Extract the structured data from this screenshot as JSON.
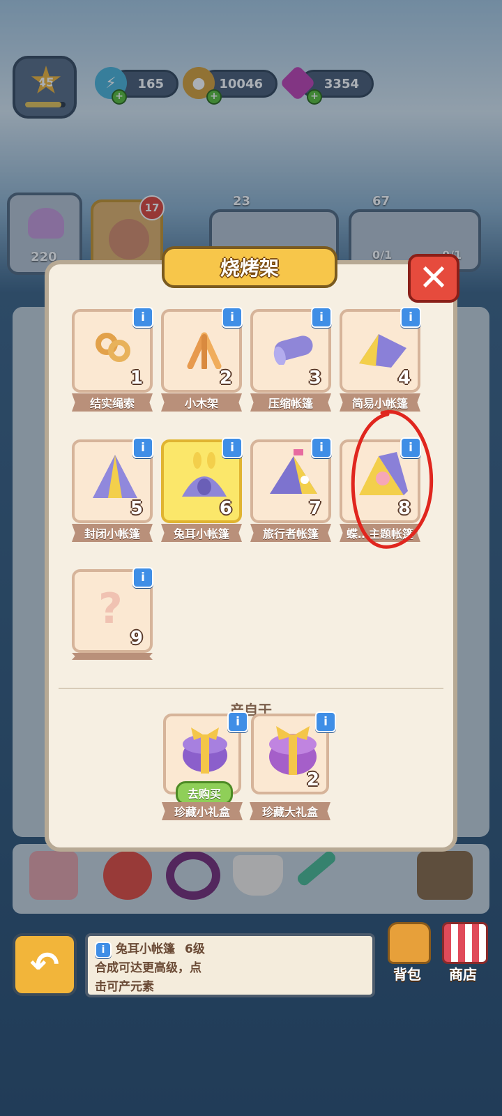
{
  "top_bar": {
    "level": "45",
    "level_progress": 0.9,
    "energy": "165",
    "coins": "10046",
    "gems": "3354"
  },
  "back_row": {
    "shell_count": "220",
    "badge_count": "17",
    "cost_a": "23",
    "cost_b": "67",
    "progress_a": "0/1",
    "progress_b": "0/1"
  },
  "modal": {
    "title": "烧烤架",
    "close_icon": "close-icon",
    "items": [
      {
        "name": "结实绳索",
        "level": "1",
        "icon": "rope-icon"
      },
      {
        "name": "小木架",
        "level": "2",
        "icon": "wood-frame-icon"
      },
      {
        "name": "压缩帐篷",
        "level": "3",
        "icon": "rolled-tent-icon"
      },
      {
        "name": "简易小帐篷",
        "level": "4",
        "icon": "tent-icon"
      },
      {
        "name": "封闭小帐篷",
        "level": "5",
        "icon": "tent-icon"
      },
      {
        "name": "兔耳小帐篷",
        "level": "6",
        "icon": "bunny-tent-icon"
      },
      {
        "name": "旅行者帐篷",
        "level": "7",
        "icon": "traveler-tent-icon"
      },
      {
        "name": "蝶…主题帐篷",
        "level": "8",
        "icon": "theme-tent-icon"
      },
      {
        "name": "",
        "level": "9",
        "icon": "question-icon"
      }
    ],
    "section_label": "产自于",
    "sources": [
      {
        "name": "珍藏小礼盒",
        "button": "去购买",
        "icon": "gift-box-icon"
      },
      {
        "name": "珍藏大礼盒",
        "level": "2",
        "icon": "gift-box-icon"
      }
    ]
  },
  "bottom": {
    "desc_title": "兔耳小帐篷",
    "desc_level": "6级",
    "desc_line1": "合成可达更高级，点",
    "desc_line2": "击可产元素",
    "bag_label": "背包",
    "shop_label": "商店"
  }
}
